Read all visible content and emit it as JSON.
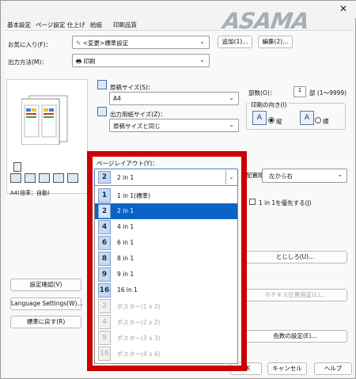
{
  "window": {
    "title_obscured": ""
  },
  "logo": {
    "text": "ASAMA"
  },
  "tabs": [
    {
      "label": "基本設定"
    },
    {
      "label": "ページ設定"
    },
    {
      "label": "仕上げ"
    },
    {
      "label": "給紙"
    },
    {
      "label": "印刷品質"
    }
  ],
  "favorites": {
    "label": "お気に入り(F)：",
    "value": "<変更>標準設定",
    "add_button": "追加(1)...",
    "edit_button": "編集(2)..."
  },
  "output_method": {
    "label": "出力方法(M)：",
    "value": "印刷"
  },
  "left_panel": {
    "caption": "A4(倍率：自動)"
  },
  "paper_size": {
    "label": "原稿サイズ(S)：",
    "value": "A4"
  },
  "output_paper_size": {
    "label": "出力用紙サイズ(Z)：",
    "value": "原稿サイズと同じ"
  },
  "copies": {
    "label": "部数(O)：",
    "value": "1",
    "range": "部 (1〜9999)"
  },
  "orientation": {
    "legend": "印刷の向き(I)",
    "portrait": "縦",
    "landscape": "横"
  },
  "page_layout": {
    "label": "ページレイアウト(Y)：",
    "value": "2 in 1",
    "options": [
      {
        "icon": "1",
        "label": "1 in 1(標準)",
        "state": "normal"
      },
      {
        "icon": "2",
        "label": "2 in 1",
        "state": "selected"
      },
      {
        "icon": "4",
        "label": "4 in 1",
        "state": "normal"
      },
      {
        "icon": "6",
        "label": "6 in 1",
        "state": "normal"
      },
      {
        "icon": "8",
        "label": "8 in 1",
        "state": "normal"
      },
      {
        "icon": "9",
        "label": "9 in 1",
        "state": "normal"
      },
      {
        "icon": "16",
        "label": "16 in 1",
        "state": "normal"
      },
      {
        "icon": "2",
        "label": "ポスター(1 x 2)",
        "state": "disabled"
      },
      {
        "icon": "4",
        "label": "ポスター(2 x 2)",
        "state": "disabled"
      },
      {
        "icon": "9",
        "label": "ポスター(3 x 3)",
        "state": "disabled"
      },
      {
        "icon": "16",
        "label": "ポスター(4 x 4)",
        "state": "disabled"
      }
    ]
  },
  "layout_order": {
    "label": "配置順(E)：",
    "value": "左から右"
  },
  "prioritize_1in1": {
    "label": "1 in 1を優先する(J)"
  },
  "right_buttons": {
    "binding": "とじしろ(U)...",
    "staple": "ホチキス位置指定(L)...",
    "color": "色数の設定(E)..."
  },
  "left_buttons": {
    "check": "設定確認(V)",
    "language": "Language Settings(W)...",
    "restore": "標準に戻す(R)"
  },
  "footer_buttons": {
    "ok": "OK",
    "cancel": "キャンセル",
    "help": "ヘルプ"
  }
}
